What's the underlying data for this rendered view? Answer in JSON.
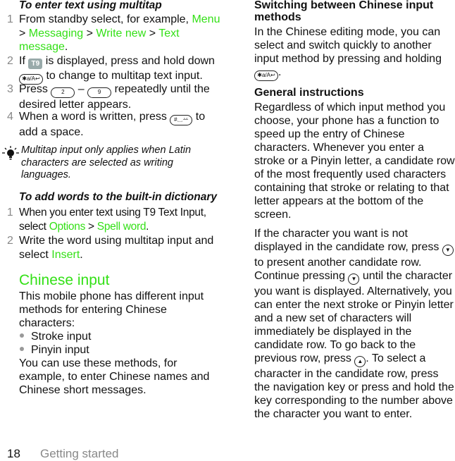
{
  "left": {
    "multitap": {
      "heading": "To enter text using multitap",
      "steps": [
        {
          "num": "1",
          "pre": "From standby select, for example, ",
          "menu1": "Menu",
          "sep1": " > ",
          "menu2": "Messaging",
          "sep2": " > ",
          "menu3": "Write new",
          "sep3": " > ",
          "menu4": "Text message",
          "post": "."
        },
        {
          "num": "2",
          "pre": "If ",
          "mid": " is displayed, press and hold down ",
          "post": " to change to multitap text input."
        },
        {
          "num": "3",
          "pre": "Press ",
          "dash": " – ",
          "post": " repeatedly until the desired letter appears."
        },
        {
          "num": "4",
          "pre": "When a word is written, press ",
          "post": " to add a space."
        }
      ]
    },
    "tip": "Multitap input only applies when Latin characters are selected as writing languages.",
    "dictionary": {
      "heading": "To add words to the built-in dictionary",
      "steps": [
        {
          "num": "1",
          "pre": "When you enter text using T9 Text Input, select ",
          "opt1": "Options",
          "sep": " > ",
          "opt2": "Spell word",
          "post": "."
        },
        {
          "num": "2",
          "pre": "Write the word using multitap input and select ",
          "opt1": "Insert",
          "post": "."
        }
      ]
    },
    "chinese": {
      "heading": "Chinese input",
      "intro": "This mobile phone has different input methods for entering Chinese characters:",
      "bullets": [
        "Stroke input",
        "Pinyin input"
      ],
      "outro": "You can use these methods, for example, to enter Chinese names and Chinese short messages."
    }
  },
  "right": {
    "switching": {
      "heading": "Switching between Chinese input methods",
      "text": "In the Chinese editing mode, you can select and switch quickly to another input method by pressing and holding",
      "post": "."
    },
    "general": {
      "heading": "General instructions",
      "p1": "Regardless of which input method you choose, your phone has a function to speed up the entry of Chinese characters. Whenever you enter a stroke or a Pinyin letter, a candidate row of the most frequently used characters containing that stroke or relating to that letter appears at the bottom of the screen.",
      "p2a": "If the character you want is not displayed in the candidate row, press ",
      "p2b": " to present another candidate row. Continue pressing ",
      "p2c": " until the character you want is displayed. Alternatively, you can enter the next stroke or Pinyin letter and a new set of characters will immediately be displayed in the candidate row. To go back to the previous row, press ",
      "p2d": ". To select a character in the candidate row, press the navigation key or press and hold the key corresponding to the number above the character you want to enter."
    }
  },
  "keys": {
    "star": "✱a/A↩",
    "two": "2",
    "nine": "9",
    "hash": "#␣䒑",
    "t9": "T9",
    "nav_down": "▼",
    "nav_up": "▲"
  },
  "footer": {
    "page": "18",
    "section": "Getting started"
  },
  "colors": {
    "accent": "#33e016",
    "step_number": "#888888"
  }
}
